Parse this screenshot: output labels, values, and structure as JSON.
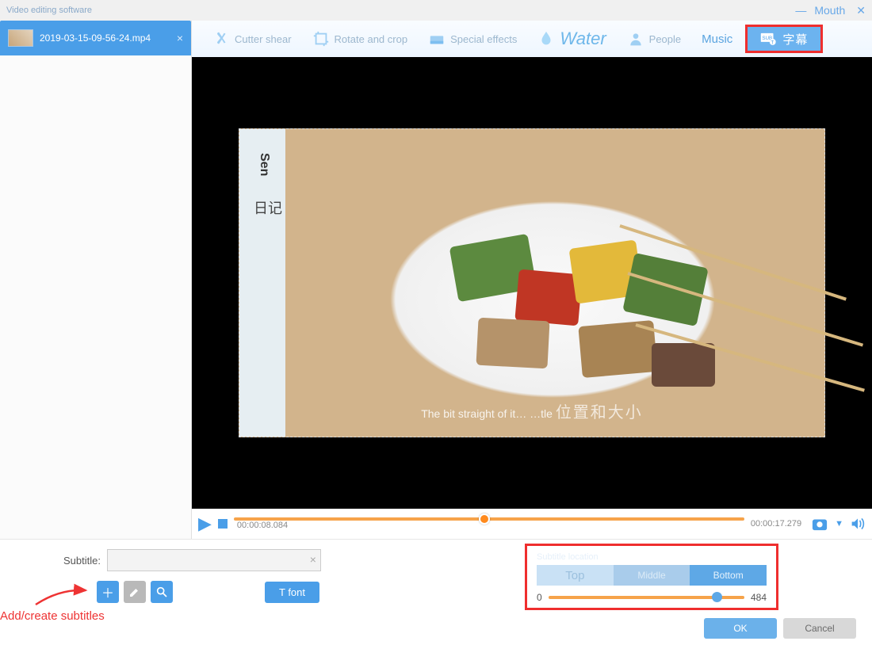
{
  "titlebar": {
    "app_title": "Video editing software",
    "label_mouth": "Mouth"
  },
  "file_tab": {
    "name": "2019-03-15-09-56-24.mp4"
  },
  "toolbar": {
    "cutter": "Cutter shear",
    "rotate": "Rotate and crop",
    "effects": "Special effects",
    "water": "Water",
    "people": "People",
    "music": "Music",
    "subtitle_glyph": "字幕",
    "subtitle_badge": "SUB"
  },
  "preview": {
    "side_en": "Sen",
    "side_cn": "日记",
    "overlay_en": "The bit straight of it… …tle",
    "overlay_cn": "位置和大小"
  },
  "playbar": {
    "current": "00:00:08.084",
    "duration": "00:00:17.279",
    "progress_pct": 48
  },
  "subtitle": {
    "label": "Subtitle:",
    "value": "",
    "font_btn": "T font",
    "annotation": "Add/create subtitles"
  },
  "panel": {
    "pos_label": "Subtitle location",
    "pos_top": "Top",
    "pos_middle": "Middle",
    "pos_bottom": "Bottom",
    "slider_min": "0",
    "slider_max": "484"
  },
  "dialog": {
    "ok": "OK",
    "cancel": "Cancel"
  }
}
